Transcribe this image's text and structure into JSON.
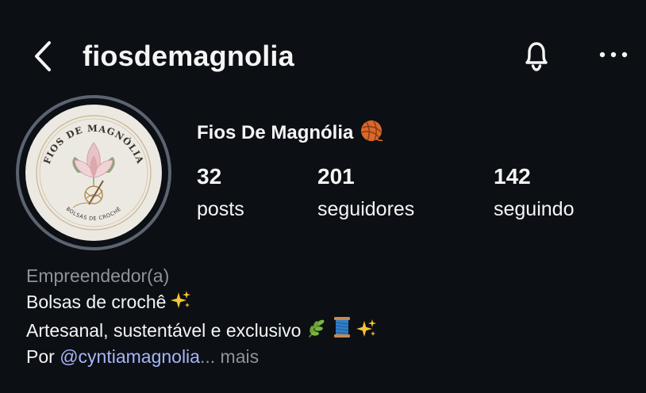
{
  "header": {
    "username": "fiosdemagnolia",
    "back_icon": "chevron-left-icon",
    "bell_icon": "bell-icon",
    "more_icon": "more-horizontal-icon"
  },
  "profile": {
    "avatar": {
      "logo_top_text": "FIOS DE MAGNÓLIA",
      "logo_bottom_text": "BOLSAS DE CROCHÊ"
    },
    "display_name": "Fios De Magnólia",
    "display_name_emoji": "yarn-ball-icon",
    "stats": {
      "posts": {
        "count": "32",
        "label": "posts"
      },
      "followers": {
        "count": "201",
        "label": "seguidores"
      },
      "following": {
        "count": "142",
        "label": "seguindo"
      }
    }
  },
  "bio": {
    "category": "Empreendedor(a)",
    "line1": "Bolsas de crochê",
    "line2": "Artesanal, sustentável e exclusivo",
    "line3_prefix": "Por ",
    "mention": "@cyntiamagnolia",
    "ellipsis": "...",
    "more": " mais"
  },
  "colors": {
    "background": "#0c0f14",
    "text": "#f5f5f5",
    "secondary_text": "#8e949c",
    "mention": "#a7b5f6",
    "avatar_ring": "#5b6470"
  }
}
